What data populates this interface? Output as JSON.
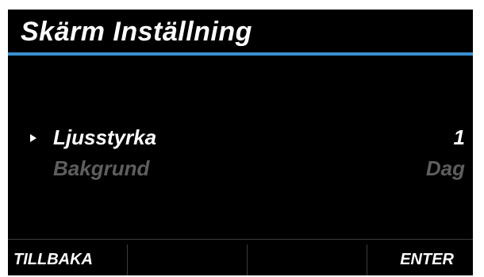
{
  "screen": {
    "title": "Skärm Inställning",
    "accent_color": "#3a8fd0",
    "background_color": "#000000"
  },
  "menu": {
    "items": [
      {
        "label": "Ljusstyrka",
        "value": "1",
        "selected": true,
        "enabled": true
      },
      {
        "label": "Bakgrund",
        "value": "Dag",
        "selected": false,
        "enabled": false
      }
    ],
    "pointer_icon": "triangle-right-icon"
  },
  "softkeys": {
    "key1": "TILLBAKA",
    "key2": "",
    "key3": "",
    "key4": "ENTER"
  }
}
